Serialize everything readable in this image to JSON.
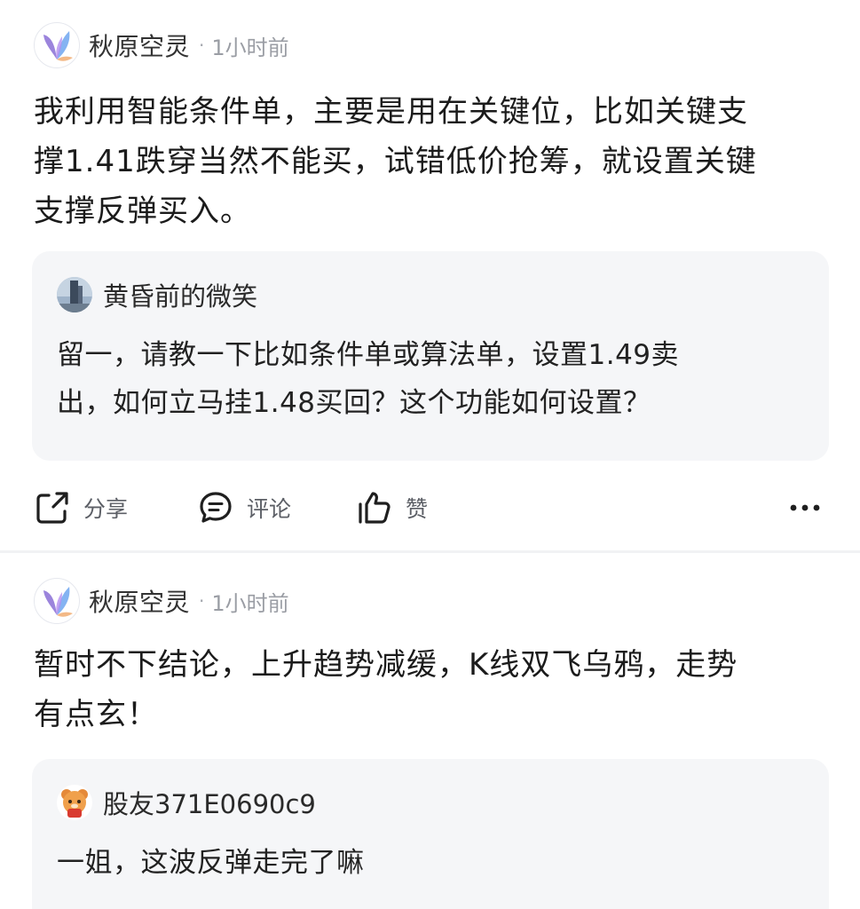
{
  "posts": [
    {
      "author": "秋原空灵",
      "separator": "·",
      "time": "1小时前",
      "content_lines": [
        "我利用智能条件单，主要是用在关键位，比如关键支",
        "撑1.41跌穿当然不能买，试错低价抢筹，就设置关键",
        "支撑反弹买入。"
      ],
      "reply": {
        "user": "黄昏前的微笑",
        "text_lines": [
          "留一，请教一下比如条件单或算法单，设置1.49卖",
          "出，如何立马挂1.48买回？这个功能如何设置？"
        ]
      },
      "actions": {
        "share": "分享",
        "comment": "评论",
        "like": "赞"
      }
    },
    {
      "author": "秋原空灵",
      "separator": "·",
      "time": "1小时前",
      "content_lines": [
        "暂时不下结论，上升趋势减缓，K线双飞乌鸦，走势",
        "有点玄！"
      ],
      "reply": {
        "user": "股友371E0690c9",
        "text_lines": [
          "一姐，这波反弹走完了嘛"
        ]
      }
    }
  ],
  "icons": {
    "author_avatar": "butterfly-logo-icon",
    "reply_avatar_1": "building-photo-avatar",
    "reply_avatar_2": "cartoon-tiger-avatar",
    "share": "share-icon",
    "comment": "comment-icon",
    "like": "thumbs-up-icon",
    "more": "more-icon"
  },
  "colors": {
    "card_background": "#f5f6f8",
    "divider": "#f1f2f4",
    "secondary_text": "#9a9da4",
    "butterfly_purple": "#8a6fd6",
    "butterfly_blue": "#6fa6f0",
    "butterfly_orange": "#f2b17a"
  }
}
